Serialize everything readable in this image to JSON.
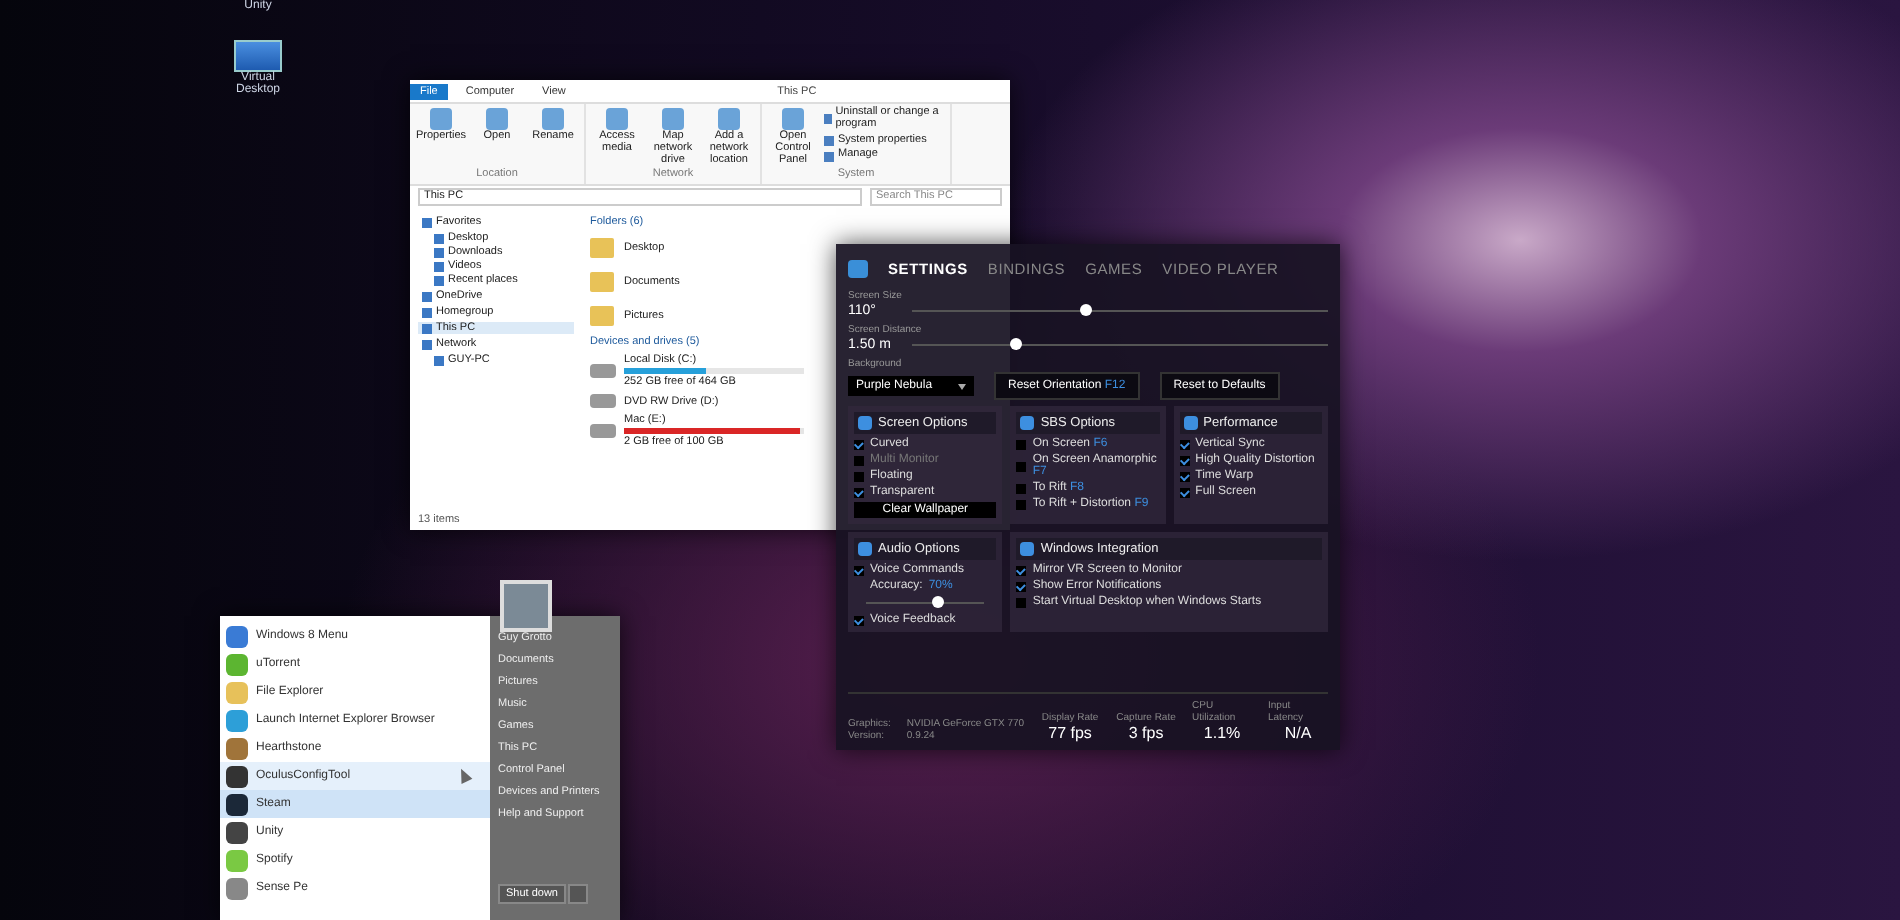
{
  "desktop_icons": [
    {
      "label": "Unity"
    },
    {
      "label": "Virtual Desktop"
    }
  ],
  "explorer": {
    "title": "This PC",
    "ribbon_tabs": [
      {
        "label": "File",
        "selected": true
      },
      {
        "label": "Computer",
        "selected": false
      },
      {
        "label": "View",
        "selected": false
      }
    ],
    "ribbon_groups": [
      {
        "label": "Location",
        "buttons": [
          "Properties",
          "Open",
          "Rename"
        ]
      },
      {
        "label": "Network",
        "buttons": [
          "Access media",
          "Map network drive",
          "Add a network location"
        ]
      },
      {
        "label": "System",
        "buttons": [
          "Open Control Panel"
        ],
        "small_buttons": [
          "Uninstall or change a program",
          "System properties",
          "Manage"
        ]
      }
    ],
    "address": "This PC",
    "search": {
      "placeholder": "Search This PC"
    },
    "nav": [
      {
        "label": "Favorites",
        "selected": false,
        "children": [
          {
            "label": "Desktop",
            "selected": false
          },
          {
            "label": "Downloads",
            "selected": false
          },
          {
            "label": "Videos",
            "selected": false
          },
          {
            "label": "Recent places",
            "selected": false
          }
        ]
      },
      {
        "label": "OneDrive",
        "selected": false
      },
      {
        "label": "Homegroup",
        "selected": false
      },
      {
        "label": "This PC",
        "selected": true
      },
      {
        "label": "Network",
        "selected": false,
        "children": [
          {
            "label": "GUY-PC",
            "selected": false
          }
        ]
      }
    ],
    "folders_heading": "Folders (6)",
    "folders": [
      "Desktop",
      "Documents",
      "Pictures"
    ],
    "devices_heading": "Devices and drives (5)",
    "drives": [
      {
        "name": "Local Disk (C:)",
        "free": "252 GB free of 464 GB",
        "level": 0.46,
        "low_space": false
      },
      {
        "name": "DVD RW Drive (D:)"
      },
      {
        "name": "Mac (E:)",
        "free": "2 GB free of 100 GB",
        "level": 0.98,
        "low_space": true
      }
    ],
    "status": "13 items"
  },
  "settings": {
    "tabs": [
      {
        "label": "SETTINGS",
        "selected": true
      },
      {
        "label": "BINDINGS",
        "selected": false
      },
      {
        "label": "GAMES",
        "selected": false
      },
      {
        "label": "VIDEO PLAYER",
        "selected": false
      }
    ],
    "sliders": [
      {
        "label": "Screen Size",
        "value": "110°",
        "level": 0.42
      },
      {
        "label": "Screen Distance",
        "value": "1.50 m",
        "level": 0.25
      }
    ],
    "background": {
      "label": "Background",
      "value": "Purple Nebula"
    },
    "buttons": [
      {
        "label": "Reset Orientation",
        "hotkey": "F12"
      },
      {
        "label": "Reset to Defaults"
      }
    ],
    "panels": [
      {
        "title": "Screen Options",
        "options": [
          {
            "label": "Curved",
            "checked": true,
            "disabled": false
          },
          {
            "label": "Multi Monitor",
            "checked": false,
            "disabled": true
          },
          {
            "label": "Floating",
            "checked": false,
            "disabled": false
          },
          {
            "label": "Transparent",
            "checked": true,
            "disabled": false
          }
        ],
        "button": "Clear Wallpaper"
      },
      {
        "title": "SBS Options",
        "options": [
          {
            "label": "On Screen",
            "hotkey": "F6",
            "checked": false,
            "disabled": false
          },
          {
            "label": "On Screen Anamorphic",
            "hotkey": "F7",
            "checked": false,
            "disabled": false
          },
          {
            "label": "To Rift",
            "hotkey": "F8",
            "checked": false,
            "disabled": false
          },
          {
            "label": "To Rift + Distortion",
            "hotkey": "F9",
            "checked": false,
            "disabled": false
          }
        ]
      },
      {
        "title": "Performance",
        "options": [
          {
            "label": "Vertical Sync",
            "checked": true,
            "disabled": false
          },
          {
            "label": "High Quality Distortion",
            "checked": true,
            "disabled": false
          },
          {
            "label": "Time Warp",
            "checked": true,
            "disabled": false
          },
          {
            "label": "Full Screen",
            "checked": true,
            "disabled": false
          }
        ]
      },
      {
        "title": "Audio Options",
        "options": [
          {
            "label": "Voice Commands",
            "checked": true,
            "disabled": false
          }
        ],
        "accuracy": {
          "label": "Accuracy:",
          "value": "70%",
          "level": 0.6
        },
        "after": [
          {
            "label": "Voice Feedback",
            "checked": true,
            "disabled": false
          }
        ]
      },
      {
        "title": "Windows Integration",
        "options": [
          {
            "label": "Mirror VR Screen to Monitor",
            "checked": true,
            "disabled": false
          },
          {
            "label": "Show Error Notifications",
            "checked": true,
            "disabled": false
          },
          {
            "label": "Start Virtual Desktop when Windows Starts",
            "checked": false,
            "disabled": false
          }
        ]
      }
    ],
    "status": {
      "labels": [
        "Graphics:",
        "Version:"
      ],
      "values": [
        "NVIDIA GeForce GTX 770",
        "0.9.24"
      ],
      "stats": [
        {
          "label": "Display Rate",
          "value": "77 fps"
        },
        {
          "label": "Capture Rate",
          "value": "3 fps"
        },
        {
          "label": "CPU Utilization",
          "value": "1.1%"
        },
        {
          "label": "Input Latency",
          "value": "N/A"
        }
      ]
    }
  },
  "start_menu": {
    "programs": [
      {
        "label": "Windows 8 Menu",
        "selected": false,
        "hover": false
      },
      {
        "label": "uTorrent",
        "selected": false,
        "hover": false
      },
      {
        "label": "File Explorer",
        "selected": false,
        "hover": false
      },
      {
        "label": "Launch Internet Explorer Browser",
        "selected": false,
        "hover": false
      },
      {
        "label": "Hearthstone",
        "selected": false,
        "hover": false
      },
      {
        "label": "OculusConfigTool",
        "selected": false,
        "hover": true
      },
      {
        "label": "Steam",
        "selected": true,
        "hover": false
      },
      {
        "label": "Unity",
        "selected": false,
        "hover": false
      },
      {
        "label": "Spotify",
        "selected": false,
        "hover": false
      },
      {
        "label": "Sense Pe",
        "selected": false,
        "hover": false
      }
    ],
    "places": [
      "Guy Grotto",
      "Documents",
      "Pictures",
      "Music",
      "Games",
      "This PC",
      "Control Panel",
      "Devices and Printers",
      "Help and Support"
    ],
    "shutdown": "Shut down"
  }
}
